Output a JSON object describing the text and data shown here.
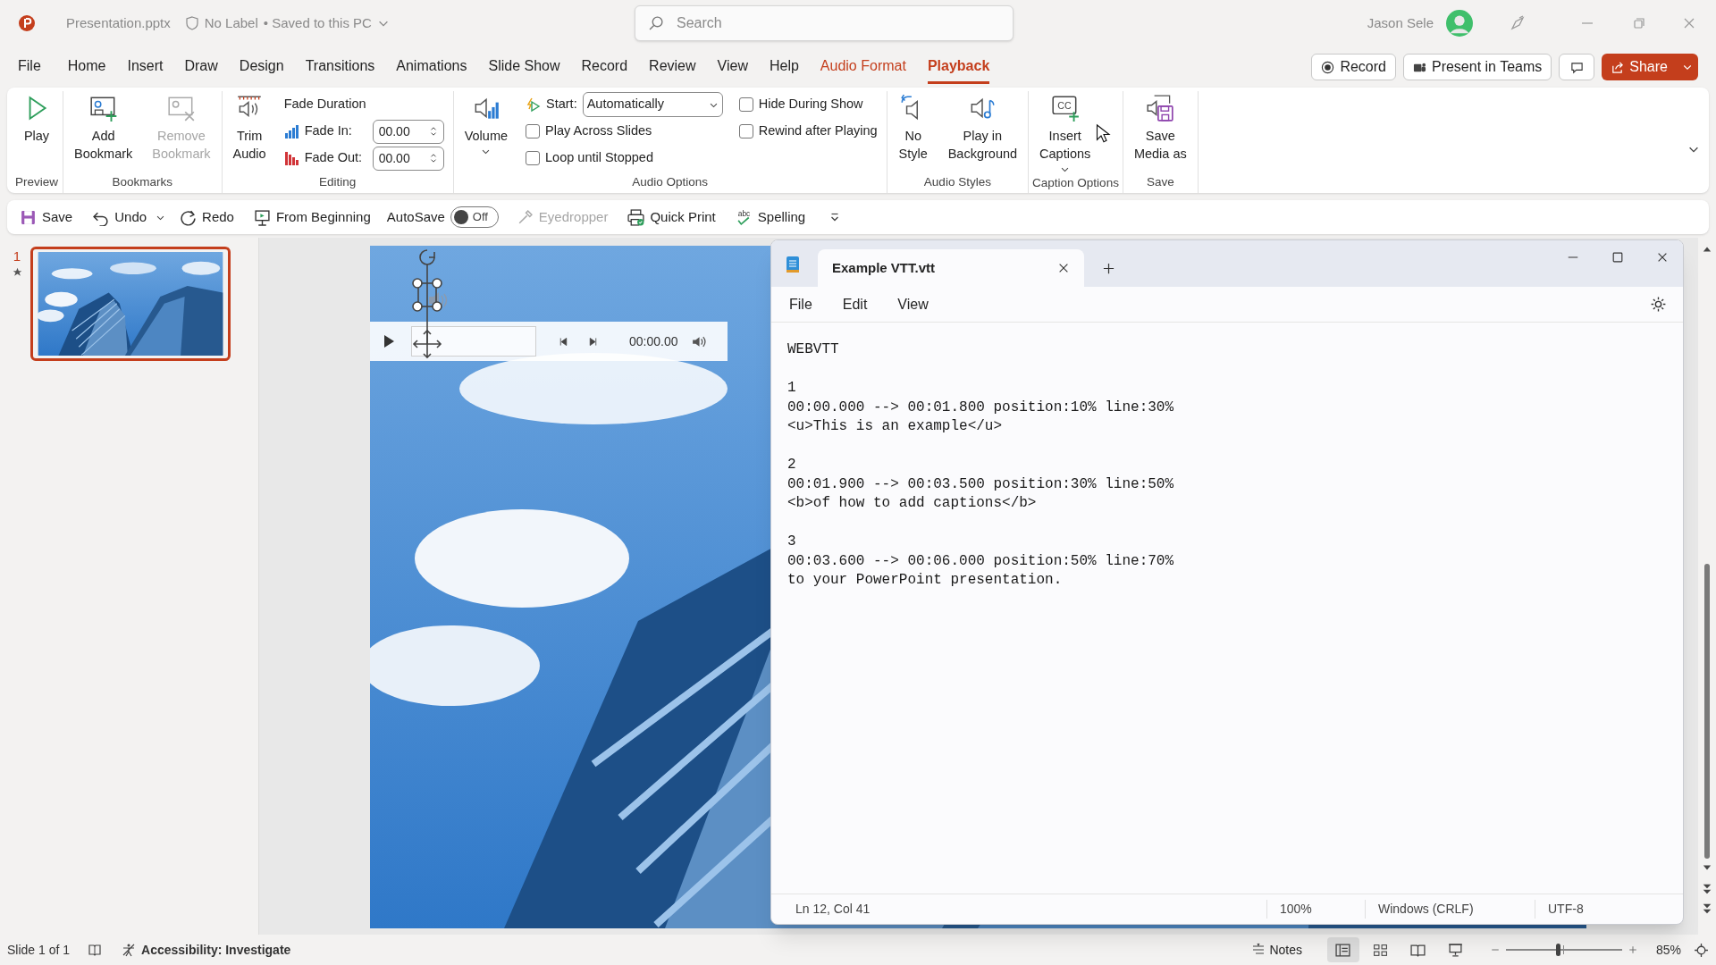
{
  "title_bar": {
    "file_name": "Presentation.pptx",
    "sensitivity_label": "No Label",
    "save_status": "• Saved to this PC",
    "search": {
      "placeholder": "Search"
    },
    "user_name": "Jason Sele"
  },
  "menu_tabs": [
    {
      "label": "File",
      "selected": false,
      "kind": "normal"
    },
    {
      "label": "Home",
      "selected": false,
      "kind": "normal"
    },
    {
      "label": "Insert",
      "selected": false,
      "kind": "normal"
    },
    {
      "label": "Draw",
      "selected": false,
      "kind": "normal"
    },
    {
      "label": "Design",
      "selected": false,
      "kind": "normal"
    },
    {
      "label": "Transitions",
      "selected": false,
      "kind": "normal"
    },
    {
      "label": "Animations",
      "selected": false,
      "kind": "normal"
    },
    {
      "label": "Slide Show",
      "selected": false,
      "kind": "normal"
    },
    {
      "label": "Record",
      "selected": false,
      "kind": "normal"
    },
    {
      "label": "Review",
      "selected": false,
      "kind": "normal"
    },
    {
      "label": "View",
      "selected": false,
      "kind": "normal"
    },
    {
      "label": "Help",
      "selected": false,
      "kind": "normal"
    },
    {
      "label": "Audio Format",
      "selected": false,
      "kind": "contextual"
    },
    {
      "label": "Playback",
      "selected": true,
      "kind": "contextual"
    }
  ],
  "header_buttons": [
    {
      "kind": "record",
      "label": "Record"
    },
    {
      "kind": "teams",
      "label": "Present in Teams"
    },
    {
      "kind": "comments"
    },
    {
      "kind": "share",
      "label": "Share"
    }
  ],
  "ribbon": {
    "groups": [
      {
        "label": "Preview",
        "items": [
          {
            "kind": "large",
            "label": "Play"
          }
        ]
      },
      {
        "label": "Bookmarks",
        "items": [
          {
            "kind": "large",
            "label": "Add\nBookmark"
          },
          {
            "kind": "large",
            "label": "Remove\nBookmark",
            "disabled": true
          }
        ]
      },
      {
        "label": "Editing",
        "items": [
          {
            "kind": "large",
            "label": "Trim\nAudio"
          },
          {
            "kind": "stack",
            "items": [
              {
                "kind": "heading",
                "label": "Fade Duration"
              },
              {
                "kind": "spin",
                "label": "Fade In:",
                "value": "00.00"
              },
              {
                "kind": "spin",
                "label": "Fade Out:",
                "value": "00.00"
              }
            ]
          }
        ]
      },
      {
        "label": "Audio Options",
        "items": [
          {
            "kind": "large",
            "label": "Volume",
            "has_menu": true
          },
          {
            "kind": "stack",
            "items": [
              {
                "kind": "dropdown",
                "label": "Start:",
                "value": "Automatically"
              },
              {
                "kind": "checkbox",
                "label": "Play Across Slides",
                "checked": false
              },
              {
                "kind": "checkbox",
                "label": "Loop until Stopped",
                "checked": false
              }
            ]
          },
          {
            "kind": "stack",
            "items": [
              {
                "kind": "checkbox",
                "label": "Hide During Show",
                "checked": false
              },
              {
                "kind": "checkbox",
                "label": "Rewind after Playing",
                "checked": false
              }
            ]
          }
        ]
      },
      {
        "label": "Audio Styles",
        "items": [
          {
            "kind": "large",
            "label": "No\nStyle"
          },
          {
            "kind": "large",
            "label": "Play in\nBackground"
          }
        ]
      },
      {
        "label": "Caption Options",
        "items": [
          {
            "kind": "large",
            "icon_text": "CC",
            "label": "Insert\nCaptions",
            "has_menu": true
          }
        ]
      },
      {
        "label": "Save",
        "items": [
          {
            "kind": "large",
            "label": "Save\nMedia as"
          }
        ]
      }
    ]
  },
  "quick_access": [
    {
      "kind": "button",
      "label": "Save"
    },
    {
      "kind": "button",
      "label": "Undo",
      "has_menu": true
    },
    {
      "kind": "button",
      "label": "Redo"
    },
    {
      "kind": "button",
      "label": "From Beginning"
    },
    {
      "kind": "toggle",
      "label": "AutoSave",
      "on": false,
      "state_label": "Off"
    },
    {
      "kind": "button",
      "label": "Eyedropper",
      "disabled": true
    },
    {
      "kind": "button",
      "label": "Quick Print"
    },
    {
      "kind": "button",
      "icon_text": "abc",
      "label": "Spelling"
    },
    {
      "kind": "overflow"
    }
  ],
  "slides": [
    {
      "number": "1",
      "selected": true,
      "has_animation": true
    }
  ],
  "slide": {
    "audio_object": {
      "selected": true
    },
    "media_player": {
      "time": "00:00.00"
    }
  },
  "notepad": {
    "tab_title": "Example VTT.vtt",
    "menu": [
      "File",
      "Edit",
      "View"
    ],
    "content": {
      "header": "WEBVTT",
      "cues": [
        {
          "id": "1",
          "timing": "00:00.000 --> 00:01.800 position:10% line:30%",
          "text": "<u>This is an example</u>"
        },
        {
          "id": "2",
          "timing": "00:01.900 --> 00:03.500 position:30% line:50%",
          "text": "<b>of how to add captions</b>"
        },
        {
          "id": "3",
          "timing": "00:03.600 --> 00:06.000 position:50% line:70%",
          "text": "to your PowerPoint presentation."
        }
      ]
    },
    "status": {
      "cursor": "Ln 12, Col 41",
      "zoom": "100%",
      "line_endings": "Windows (CRLF)",
      "encoding": "UTF-8"
    }
  },
  "status_bar": {
    "slide_info": "Slide 1 of 1",
    "accessibility": "Accessibility: Investigate",
    "notes": "Notes",
    "views": [
      {
        "kind": "normal",
        "selected": true
      },
      {
        "kind": "sorter",
        "selected": false
      },
      {
        "kind": "reading",
        "selected": false
      },
      {
        "kind": "slideshow",
        "selected": false
      }
    ],
    "zoom": {
      "level": 0.45,
      "reading": "85%"
    }
  }
}
